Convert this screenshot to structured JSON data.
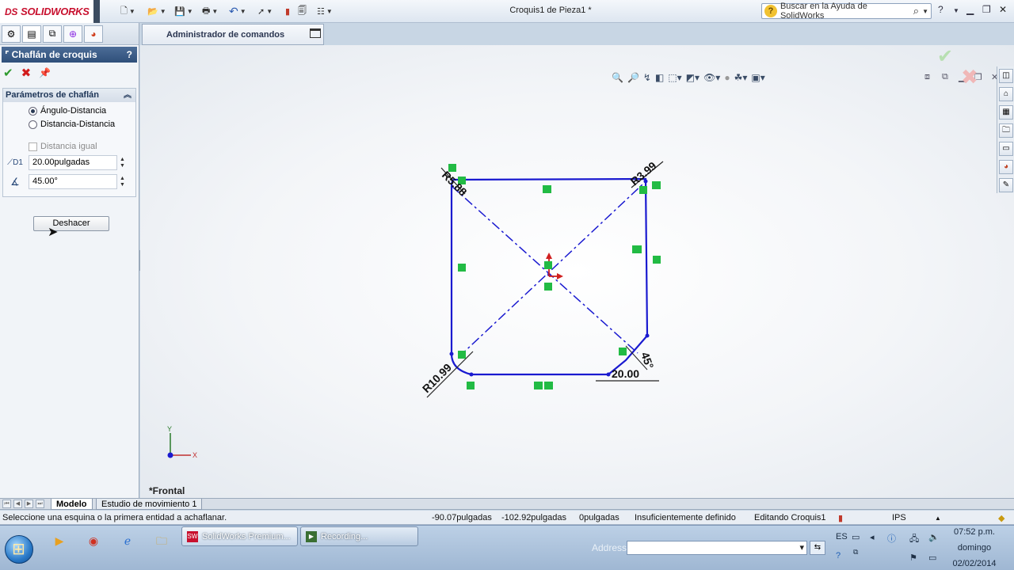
{
  "app": {
    "brand": "SOLIDWORKS",
    "brand_prefix": "DS",
    "document_title": "Croquis1 de Pieza1 *",
    "help_search_placeholder": "Buscar en la Ayuda de SolidWorks"
  },
  "colors": {
    "sketch_blue": "#1a1ad0",
    "relation_green": "#22bb44",
    "pm_header": "#2f4f7a",
    "ok_green": "#2d9a2d",
    "cancel_red": "#d21c1c"
  },
  "property_manager": {
    "title": "Chaflán de croquis",
    "help_label": "?",
    "group_title": "Parámetros de chaflán",
    "options": [
      {
        "label": "Ángulo-Distancia",
        "selected": true
      },
      {
        "label": "Distancia-Distancia",
        "selected": false
      }
    ],
    "equal_distance_label": "Distancia igual",
    "distance_value": "20.00pulgadas",
    "angle_value": "45.00°",
    "undo_button": "Deshacer"
  },
  "command_manager": {
    "label": "Administrador de comandos"
  },
  "sketch": {
    "dimensions": {
      "top_left": "R5.88",
      "top_right": "R3.99",
      "bottom_left": "R10.99",
      "chamfer_distance": "20.00",
      "chamfer_angle": "45°"
    },
    "view_label": "*Frontal",
    "axis_y": "Y",
    "axis_x": "X"
  },
  "bottom_tabs": {
    "model": "Modelo",
    "motion_study": "Estudio de movimiento 1"
  },
  "status_bar": {
    "prompt": "Seleccione una esquina o la primera entidad a achaflanar.",
    "x": "-90.07pulgadas",
    "y": "-102.92pulgadas",
    "z": "0pulgadas",
    "definition": "Insuficientemente definido",
    "mode": "Editando Croquis1",
    "units": "IPS"
  },
  "taskbar": {
    "tasks": [
      {
        "label": "SolidWorks Premium...",
        "icon": "solidworks-icon"
      },
      {
        "label": "Recording...",
        "icon": "recording-icon"
      }
    ],
    "address_label": "Address",
    "lang": "ES",
    "clock_time": "07:52 p.m.",
    "clock_day": "domingo",
    "clock_date": "02/02/2014"
  }
}
